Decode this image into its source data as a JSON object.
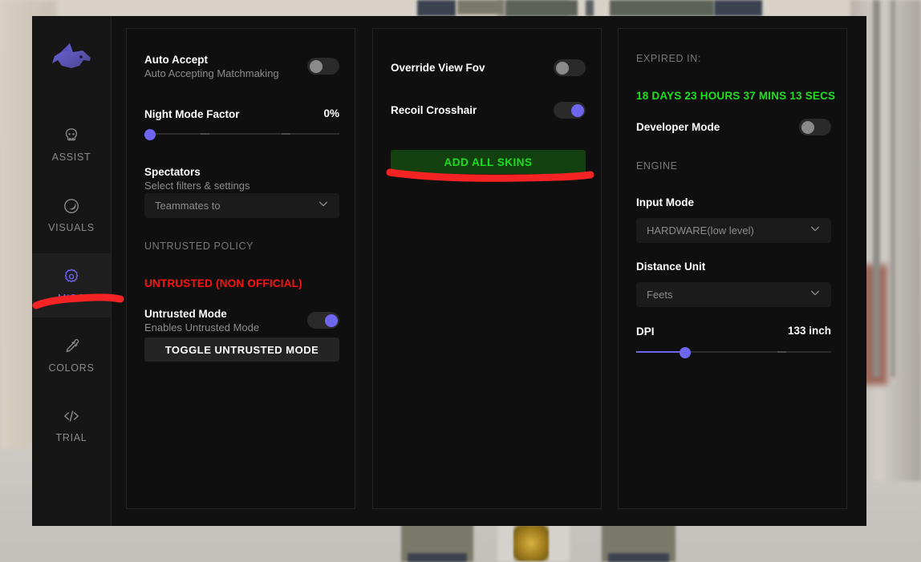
{
  "app": {
    "logo_icon": "wolf-head-logo"
  },
  "sidebar": {
    "items": [
      {
        "label": "ASSIST",
        "icon": "skull-icon",
        "active": false
      },
      {
        "label": "VISUALS",
        "icon": "moon-circle-icon",
        "active": false
      },
      {
        "label": "MISC",
        "icon": "gear-icon",
        "active": true
      },
      {
        "label": "COLORS",
        "icon": "eyedropper-icon",
        "active": false
      },
      {
        "label": "TRIAL",
        "icon": "code-icon",
        "active": false
      }
    ]
  },
  "panel1": {
    "auto_accept": {
      "title": "Auto Accept",
      "subtitle": "Auto Accepting Matchmaking",
      "toggle_on": false
    },
    "night_mode_factor": {
      "label": "Night Mode Factor",
      "value": "0%",
      "percent": 0
    },
    "spectators": {
      "title": "Spectators",
      "subtitle": "Select filters & settings",
      "select_value": "Teammates to",
      "chevron_icon": "chevron-down-icon"
    },
    "untrusted_policy_header": "UNTRUSTED POLICY",
    "untrusted_status": "UNTRUSTED (NON OFFICIAL)",
    "untrusted_mode": {
      "title": "Untrusted Mode",
      "subtitle": "Enables Untrusted Mode",
      "toggle_on": true
    },
    "toggle_untrusted_button": "TOGGLE UNTRUSTED MODE"
  },
  "panel2": {
    "override_view_fov": {
      "title": "Override View Fov",
      "toggle_on": false
    },
    "recoil_crosshair": {
      "title": "Recoil Crosshair",
      "toggle_on": true
    },
    "add_all_skins_button": "ADD ALL SKINS"
  },
  "panel3": {
    "expired_in_header": "EXPIRED IN:",
    "expired_in_value": "18 DAYS 23 HOURS 37 MINS 13 SECS",
    "developer_mode": {
      "title": "Developer Mode",
      "toggle_on": false
    },
    "engine_header": "ENGINE",
    "input_mode": {
      "label": "Input Mode",
      "select_value": "HARDWARE(low level)",
      "chevron_icon": "chevron-down-icon"
    },
    "distance_unit": {
      "label": "Distance Unit",
      "select_value": "Feets",
      "chevron_icon": "chevron-down-icon"
    },
    "dpi": {
      "label": "DPI",
      "value": "133 inch",
      "percent": 25
    }
  },
  "colors": {
    "accent_purple": "#6f66f0",
    "danger_red": "#ff1111",
    "success_green": "#1fe01f",
    "green_button_bg": "#12410f",
    "annotation_red": "#f52323",
    "panel_bg": "#0f0f0f",
    "sidebar_bg": "#161616",
    "window_bg": "#111111"
  },
  "annotations": [
    {
      "name": "red-underline-misc"
    },
    {
      "name": "red-underline-add-all-skins"
    }
  ]
}
